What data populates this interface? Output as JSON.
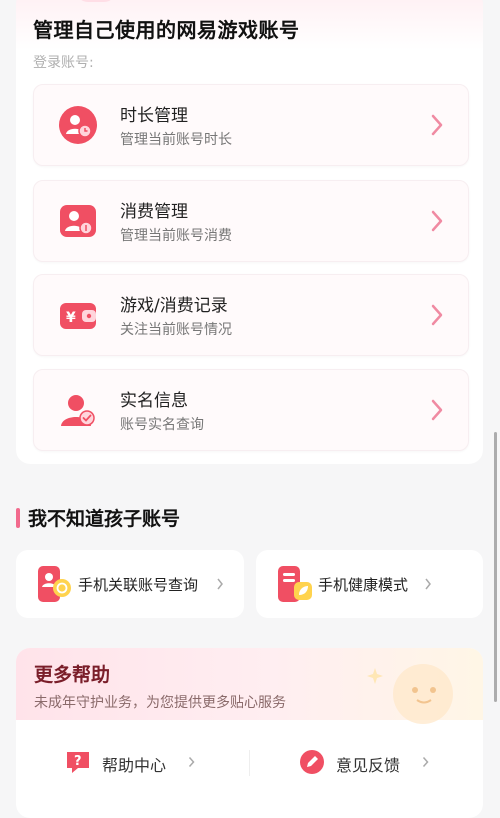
{
  "account_section": {
    "title": "管理自己使用的网易游戏账号",
    "login_label": "登录账号:",
    "items": [
      {
        "title": "时长管理",
        "subtitle": "管理当前账号时长",
        "icon": "user-clock-icon"
      },
      {
        "title": "消费管理",
        "subtitle": "管理当前账号消费",
        "icon": "user-coin-icon"
      },
      {
        "title": "游戏/消费记录",
        "subtitle": "关注当前账号情况",
        "icon": "wallet-yen-icon"
      },
      {
        "title": "实名信息",
        "subtitle": "账号实名查询",
        "icon": "user-verified-icon"
      }
    ]
  },
  "child_section": {
    "title": "我不知道孩子账号",
    "cards": [
      {
        "label": "手机关联账号查询",
        "icon": "phone-link-icon"
      },
      {
        "label": "手机健康模式",
        "icon": "phone-leaf-icon"
      }
    ]
  },
  "help_section": {
    "title": "更多帮助",
    "subtitle": "未成年守护业务，为您提供更多贴心服务",
    "buttons": [
      {
        "label": "帮助中心",
        "icon": "question-chat-icon"
      },
      {
        "label": "意见反馈",
        "icon": "pen-feedback-icon"
      }
    ]
  },
  "colors": {
    "accent": "#f26a8d",
    "icon_red": "#f04f63",
    "chevron": "#f08aa2",
    "background": "#f6f6f7"
  }
}
